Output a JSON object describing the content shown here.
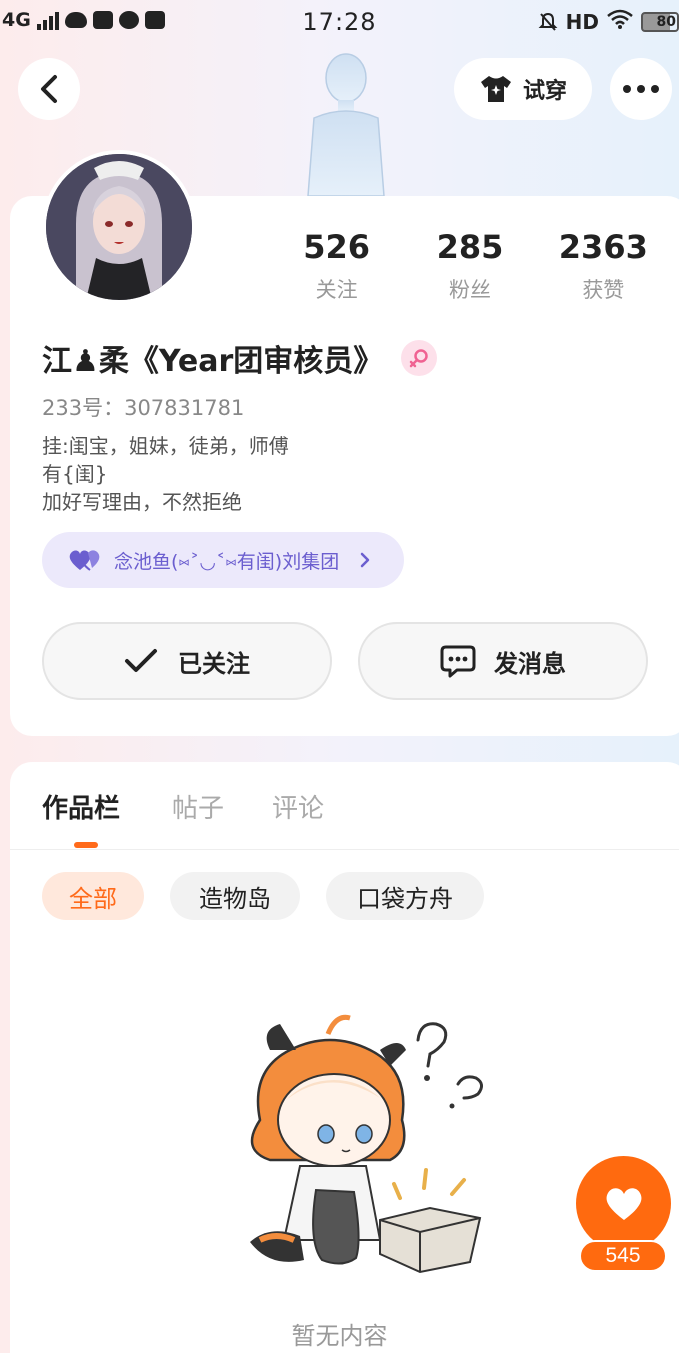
{
  "status_bar": {
    "network": "4G",
    "time": "17:28",
    "hd": "HD",
    "battery": "80"
  },
  "header": {
    "try_on_label": "试穿"
  },
  "profile": {
    "stats": [
      {
        "value": "526",
        "label": "关注"
      },
      {
        "value": "285",
        "label": "粉丝"
      },
      {
        "value": "2363",
        "label": "获赞"
      }
    ],
    "nickname": "江♟柔《Year团审核员》",
    "uid": "233号：307831781",
    "bio_lines": [
      "挂:闺宝，姐妹，徒弟，师傅",
      "有{闺}",
      "加好写理由，不然拒绝"
    ],
    "group_label": "念池鱼(⑅˃◡˂⑅有闺)刘集团",
    "follow_label": "已关注",
    "message_label": "发消息"
  },
  "works": {
    "tabs": [
      "作品栏",
      "帖子",
      "评论"
    ],
    "filters": [
      "全部",
      "造物岛",
      "口袋方舟"
    ],
    "empty_text": "暂无内容"
  },
  "like": {
    "count": "545"
  },
  "colors": {
    "accent": "#ff6a0f",
    "group_chip": "#ece9fb",
    "group_text": "#6b5ecf",
    "gender_badge": "#fde0ea"
  }
}
